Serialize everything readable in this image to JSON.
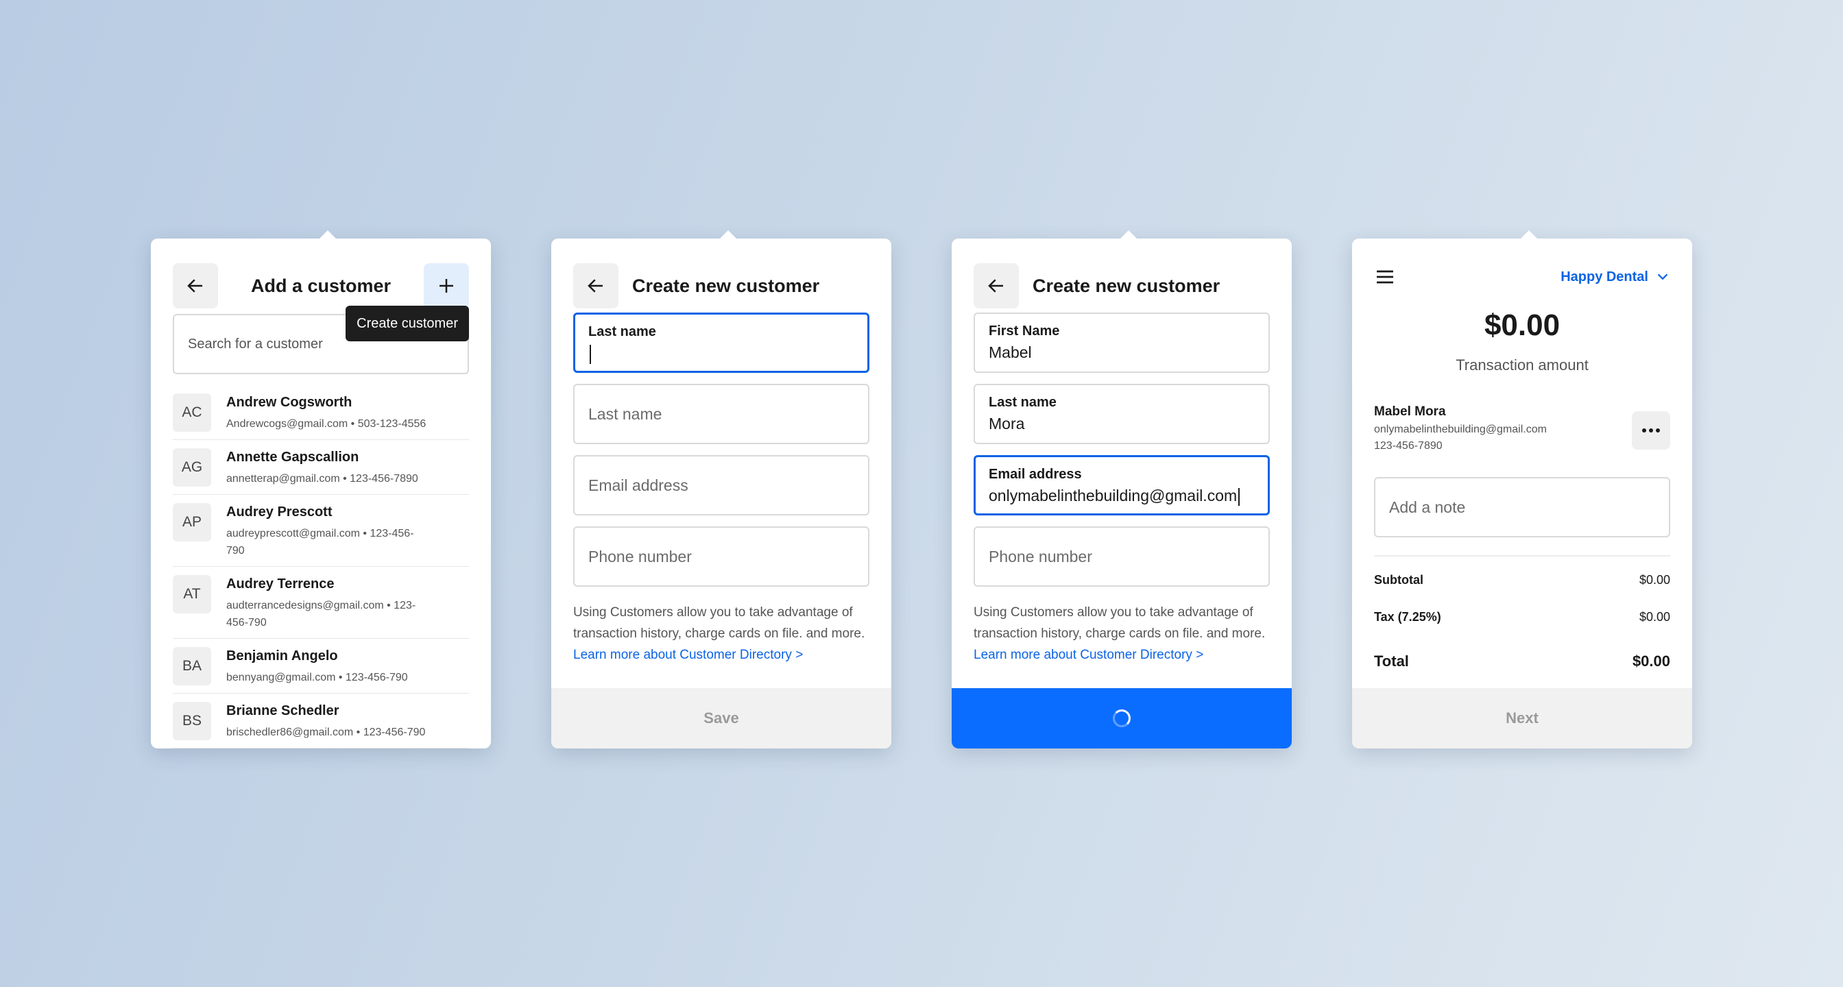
{
  "panel1": {
    "title": "Add a customer",
    "tooltip": "Create customer",
    "search_placeholder": "Search for a customer",
    "customers": [
      {
        "initials": "AC",
        "name": "Andrew Cogsworth",
        "detail": "Andrewcogs@gmail.com • 503-123-4556"
      },
      {
        "initials": "AG",
        "name": "Annette Gapscallion",
        "detail": "annetterap@gmail.com • 123-456-7890"
      },
      {
        "initials": "AP",
        "name": "Audrey Prescott",
        "detail": "audreyprescott@gmail.com • 123-456-790"
      },
      {
        "initials": "AT",
        "name": "Audrey Terrence",
        "detail": "audterrancedesigns@gmail.com • 123-456-790"
      },
      {
        "initials": "BA",
        "name": "Benjamin Angelo",
        "detail": "bennyang@gmail.com • 123-456-790"
      },
      {
        "initials": "BS",
        "name": "Brianne Schedler",
        "detail": "brischedler86@gmail.com • 123-456-790"
      }
    ]
  },
  "panel2": {
    "title": "Create new customer",
    "field1_label": "Last name",
    "field2_placeholder": "Last name",
    "field3_placeholder": "Email address",
    "field4_placeholder": "Phone number",
    "info_text": "Using Customers allow you to take advantage of transaction history, charge cards on file. and more.",
    "info_link": "Learn more about Customer Directory >",
    "save_label": "Save"
  },
  "panel3": {
    "title": "Create new customer",
    "first_name_label": "First Name",
    "first_name_value": "Mabel",
    "last_name_label": "Last name",
    "last_name_value": "Mora",
    "email_label": "Email address",
    "email_value": "onlymabelinthebuilding@gmail.com",
    "phone_placeholder": "Phone number",
    "info_text": "Using Customers allow you to take advantage of transaction history, charge cards on file. and more.",
    "info_link": "Learn more about Customer Directory >"
  },
  "panel4": {
    "business": "Happy Dental",
    "amount": "$0.00",
    "amount_label": "Transaction amount",
    "customer_name": "Mabel Mora",
    "customer_email": "onlymabelinthebuilding@gmail.com",
    "customer_phone": "123-456-7890",
    "note_placeholder": "Add a note",
    "subtotal_label": "Subtotal",
    "subtotal_value": "$0.00",
    "tax_label": "Tax (7.25%)",
    "tax_value": "$0.00",
    "total_label": "Total",
    "total_value": "$0.00",
    "next_label": "Next"
  },
  "icons": [
    "arrow-left-icon",
    "plus-icon",
    "hamburger-icon",
    "chevron-down-icon",
    "more-icon",
    "spinner-icon"
  ],
  "colors": {
    "accent": "#0b6dff",
    "link": "#0b63e5"
  }
}
